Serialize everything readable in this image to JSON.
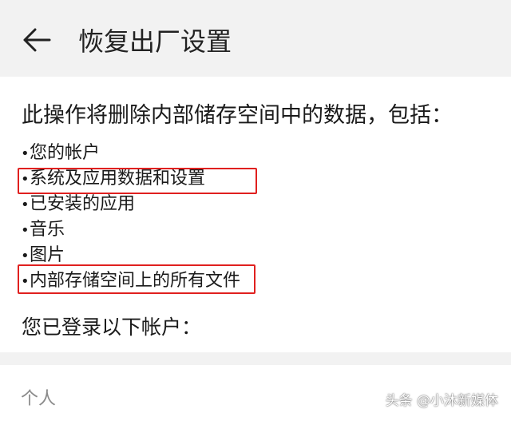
{
  "header": {
    "back_icon": "arrow-left-icon",
    "title": "恢复出厂设置"
  },
  "main": {
    "intro": "此操作将删除内部储存空间中的数据，包括：",
    "items": [
      "您的帐户",
      "系统及应用数据和设置",
      "已安装的应用",
      "音乐",
      "图片",
      "内部存储空间上的所有文件"
    ],
    "bullet": "•",
    "accounts_label": "您已登录以下帐户：",
    "personal_label": "个人"
  },
  "watermark": "头条 @小沐新媒体",
  "colors": {
    "header_bg": "#f2f2f2",
    "highlight": "#e0201f",
    "muted_text": "#8a8a8a"
  }
}
